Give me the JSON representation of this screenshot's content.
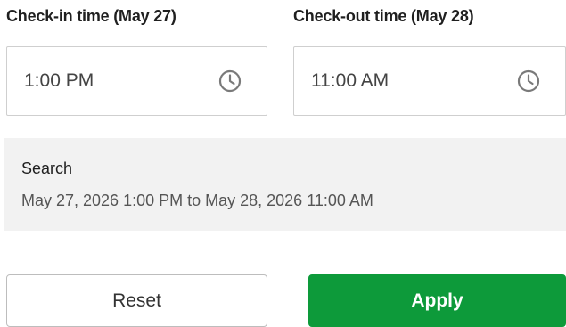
{
  "checkin": {
    "label": "Check-in time (May 27)",
    "value": "1:00 PM"
  },
  "checkout": {
    "label": "Check-out time (May 28)",
    "value": "11:00 AM"
  },
  "search": {
    "heading": "Search",
    "summary": "May 27, 2026 1:00 PM to May 28, 2026 11:00 AM"
  },
  "actions": {
    "reset_label": "Reset",
    "apply_label": "Apply"
  },
  "icons": {
    "time_picker": "clock-icon"
  },
  "colors": {
    "apply_background": "#0d9a3a",
    "panel_background": "#f2f2f2",
    "input_border": "#cfcfcf"
  }
}
